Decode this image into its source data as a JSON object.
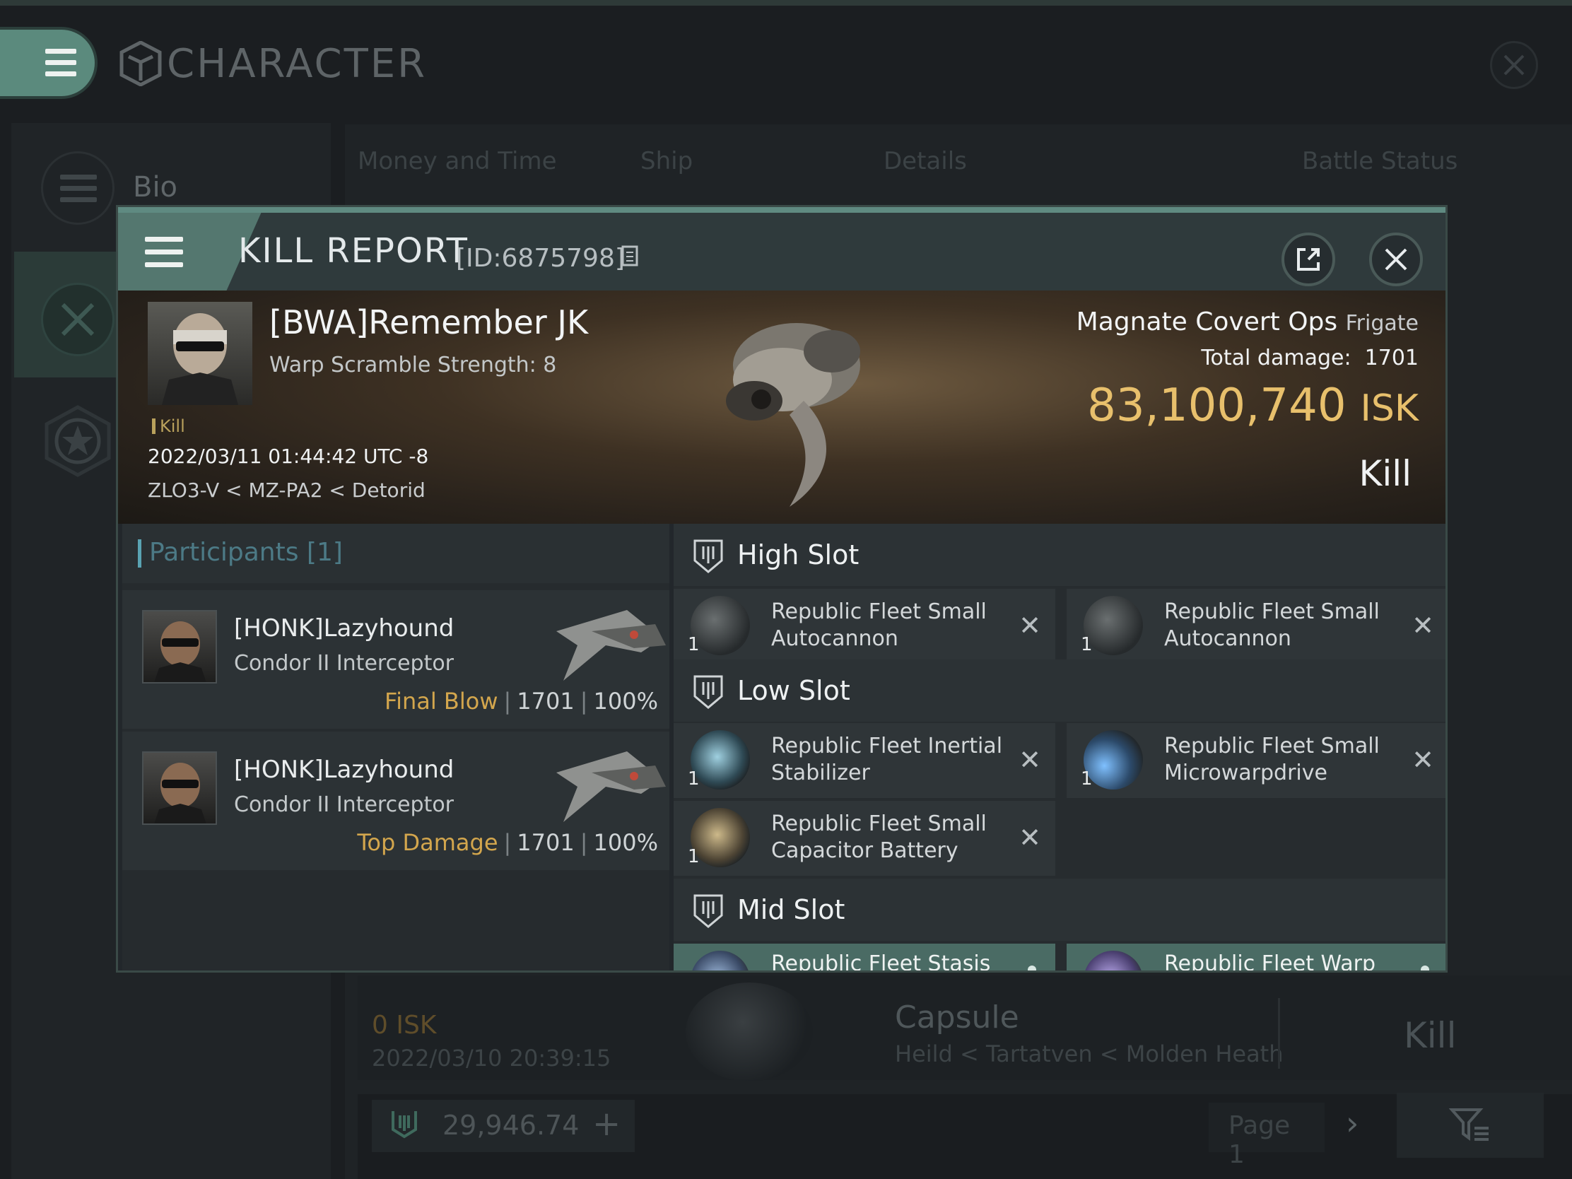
{
  "app": {
    "title": "CHARACTER"
  },
  "sidebar": {
    "items": [
      {
        "label": "Bio"
      }
    ]
  },
  "background": {
    "tabs": [
      "Money and Time",
      "Ship",
      "Details",
      "Battle Status"
    ],
    "row": {
      "isk": "0  ISK",
      "date": "2022/03/10  20:39:15",
      "ship": "Capsule",
      "location": "Heild < Tartatven < Molden Heath",
      "result": "Kill"
    },
    "wallet": "29,946.74",
    "page": "Page 1"
  },
  "dialog": {
    "title": "KILL REPORT",
    "id": "[ID:6875798]",
    "victim": {
      "name": "[BWA]Remember JK",
      "sub": "Warp Scramble Strength: 8",
      "tag": "Kill",
      "date": "2022/03/11 01:44:42 UTC -8",
      "location": "ZLO3-V < MZ-PA2 < Detorid"
    },
    "ship": {
      "name": "Magnate Covert Ops",
      "class": "Frigate"
    },
    "total_damage_label": "Total damage:",
    "total_damage": "1701",
    "isk_value": "83,100,740",
    "isk_unit": "ISK",
    "result": "Kill",
    "participants": {
      "label": "Participants",
      "count": "[1]",
      "rows": [
        {
          "name": "[HONK]Lazyhound",
          "ship": "Condor II Interceptor",
          "role": "Final Blow",
          "damage": "1701",
          "percent": "100%"
        },
        {
          "name": "[HONK]Lazyhound",
          "ship": "Condor II Interceptor",
          "role": "Top Damage",
          "damage": "1701",
          "percent": "100%"
        }
      ]
    },
    "slots": {
      "high": {
        "label": "High Slot",
        "modules": [
          {
            "qty": "1",
            "name": "Republic Fleet Small Autocannon"
          },
          {
            "qty": "1",
            "name": "Republic Fleet Small Autocannon"
          }
        ]
      },
      "low": {
        "label": "Low Slot",
        "modules": [
          {
            "qty": "1",
            "name": "Republic Fleet Inertial Stabilizer"
          },
          {
            "qty": "1",
            "name": "Republic Fleet Small Microwarpdrive"
          },
          {
            "qty": "1",
            "name": "Republic Fleet Small Capacitor Battery"
          }
        ]
      },
      "mid": {
        "label": "Mid Slot",
        "modules": [
          {
            "name": "Republic Fleet Stasis"
          },
          {
            "name": "Republic Fleet Warp"
          }
        ]
      }
    }
  }
}
